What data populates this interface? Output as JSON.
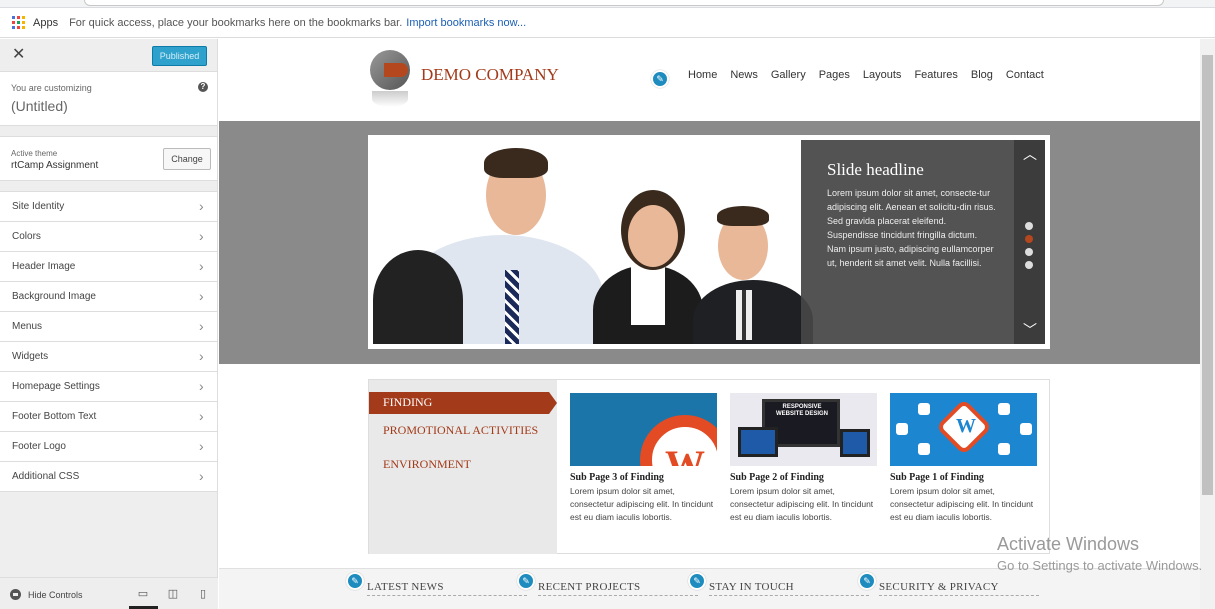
{
  "browser": {
    "apps_label": "Apps",
    "bookmark_hint": "For quick access, place your bookmarks here on the bookmarks bar.",
    "import_link": "Import bookmarks now..."
  },
  "sidebar": {
    "close_icon": "close-icon",
    "publish_label": "Published",
    "customizing_label": "You are customizing",
    "customizing_title": "(Untitled)",
    "active_theme_label": "Active theme",
    "active_theme_name": "rtCamp Assignment",
    "change_label": "Change",
    "items": [
      {
        "label": "Site Identity"
      },
      {
        "label": "Colors"
      },
      {
        "label": "Header Image"
      },
      {
        "label": "Background Image"
      },
      {
        "label": "Menus"
      },
      {
        "label": "Widgets"
      },
      {
        "label": "Homepage Settings"
      },
      {
        "label": "Footer Bottom Text"
      },
      {
        "label": "Footer Logo"
      },
      {
        "label": "Additional CSS"
      }
    ],
    "hide_controls": "Hide Controls"
  },
  "site": {
    "logo_text": "DEMO COMPANY",
    "nav": [
      "Home",
      "News",
      "Gallery",
      "Pages",
      "Layouts",
      "Features",
      "Blog",
      "Contact"
    ],
    "slide": {
      "headline": "Slide headline",
      "body": "Lorem ipsum dolor sit amet, consecte-tur adipiscing elit. Aenean et solicitu-din risus. Sed gravida placerat eleifend. Suspendisse tincidunt fringilla dictum. Nam ipsum justo, adipiscing eullamcorper ut, henderit sit amet velit. Nulla facillisi.",
      "dots": 4,
      "active_dot": 2
    },
    "tabs": [
      "FINDING",
      "PROMOTIONAL ACTIVITIES",
      "ENVIRONMENT"
    ],
    "cards": [
      {
        "title": "Sub Page 3 of Finding",
        "text": "Lorem ipsum dolor sit amet, consectetur adipiscing elit. In tincidunt est eu diam iaculis lobortis."
      },
      {
        "title": "Sub Page 2 of Finding",
        "text": "Lorem ipsum dolor sit amet, consectetur adipiscing elit. In tincidunt est eu diam iaculis lobortis.",
        "thumb_text": "RESPONSIVE WEBSITE DESIGN"
      },
      {
        "title": "Sub Page 1 of Finding",
        "text": "Lorem ipsum dolor sit amet, consectetur adipiscing elit. In tincidunt est eu diam iaculis lobortis."
      }
    ],
    "footer_heads": [
      "LATEST NEWS",
      "RECENT PROJECTS",
      "STAY IN TOUCH",
      "SECURITY & PRIVACY"
    ]
  },
  "watermark": {
    "line1": "Activate Windows",
    "line2": "Go to Settings to activate Windows."
  },
  "colors": {
    "accent": "#2ea2cc",
    "brand": "#a33a19",
    "edit_pencil": "#1e8cbe"
  }
}
